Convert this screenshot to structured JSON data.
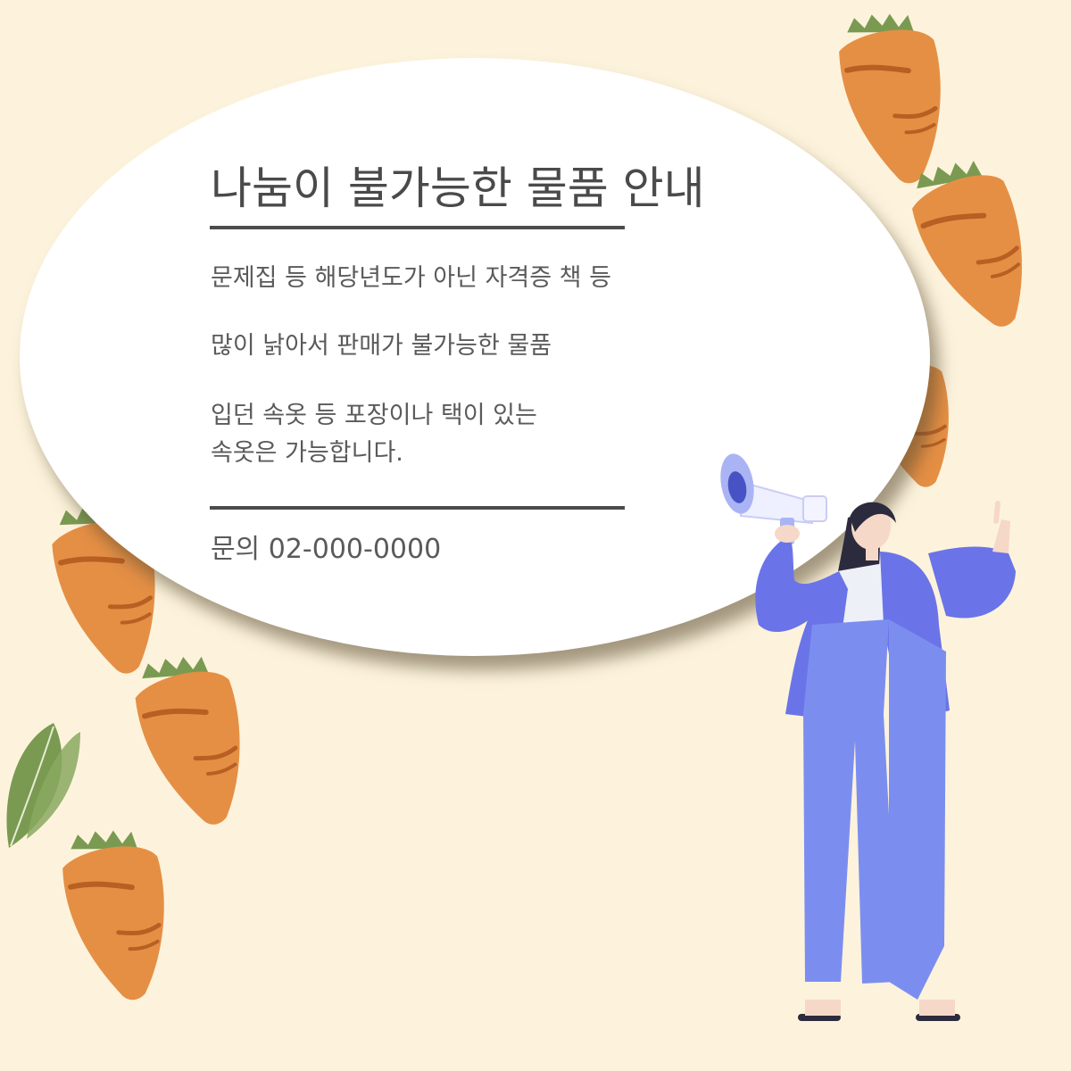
{
  "poster": {
    "title": "나눔이 불가능한 물품 안내",
    "items": [
      "문제집 등 해당년도가 아닌 자격증 책 등",
      "많이 낡아서 판매가 불가능한 물품",
      "입던 속옷 등 포장이나 택이 있는",
      "속옷은 가능합니다."
    ],
    "contact": "문의 02-000-0000"
  },
  "colors": {
    "background": "#fdf3dc",
    "carrot": "#e58f45",
    "carrot_stripe": "#b85f23",
    "leaf": "#7a9a52",
    "jacket": "#6a74e8",
    "pants": "#7b8ef0",
    "text": "#5a5a5a"
  },
  "decorations": {
    "carrot_icon": "carrot-icon",
    "person_icon": "woman-with-megaphone-icon",
    "leaf_icon": "leaf-icon"
  }
}
